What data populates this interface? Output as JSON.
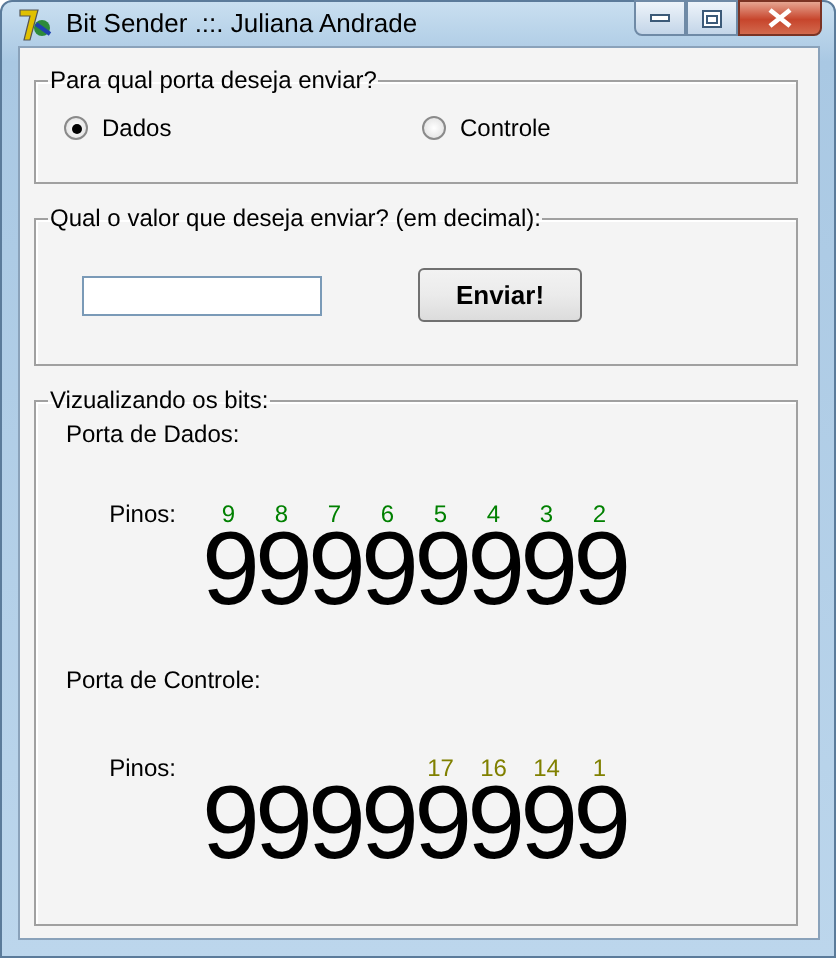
{
  "window": {
    "title": "Bit Sender .::. Juliana Andrade"
  },
  "port_group": {
    "legend": "Para qual porta deseja enviar?",
    "options": [
      {
        "label": "Dados",
        "selected": true
      },
      {
        "label": "Controle",
        "selected": false
      }
    ]
  },
  "value_group": {
    "legend": "Qual o valor que deseja enviar? (em decimal):",
    "button": "Enviar!"
  },
  "bits_group": {
    "legend": "Vizualizando os bits:",
    "ports": [
      {
        "title": "Porta de Dados:",
        "pins_label": "Pinos:",
        "color": "#008000",
        "pins": [
          "9",
          "8",
          "7",
          "6",
          "5",
          "4",
          "3",
          "2"
        ],
        "bits": "99999999"
      },
      {
        "title": "Porta de Controle:",
        "pins_label": "Pinos:",
        "color": "#808000",
        "pins": [
          "17",
          "16",
          "14",
          "1"
        ],
        "bits": "99999999"
      }
    ]
  }
}
